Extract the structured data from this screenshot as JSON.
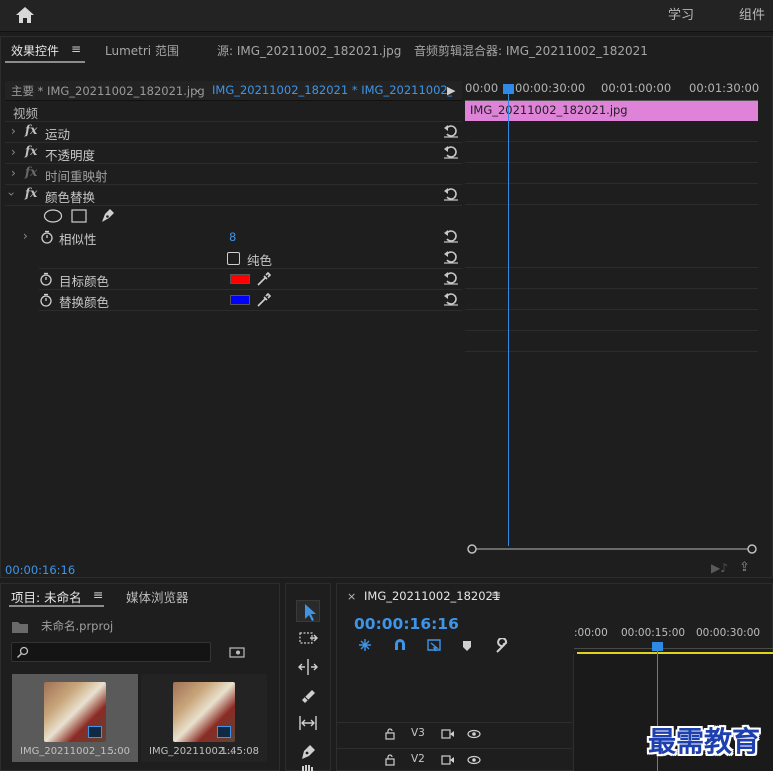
{
  "topbar": {
    "learn": "学习",
    "assembly": "组件"
  },
  "tabs": {
    "effect_controls": "效果控件",
    "lumetri": "Lumetri 范围",
    "source": "源: IMG_20211002_182021.jpg",
    "audio_mixer": "音频剪辑混合器: IMG_20211002_182021"
  },
  "clip_header": {
    "master": "主要 * IMG_20211002_182021.jpg",
    "sequence": "IMG_20211002_182021 * IMG_20211002_..."
  },
  "effects": {
    "video_heading": "视频",
    "motion": "运动",
    "opacity": "不透明度",
    "time_remap": "时间重映射",
    "color_replace": "颜色替换",
    "similarity": "相似性",
    "similarity_value": "8",
    "solid_color": "纯色",
    "target_color": "目标颜色",
    "target_color_hex": "#ff0000",
    "replace_color": "替换颜色",
    "replace_color_hex": "#0000ff"
  },
  "fx_timeline": {
    "tc0": "00:00",
    "tc1": "00:00:30:00",
    "tc2": "00:01:00:00",
    "tc3": "00:01:30:00",
    "clip_label": "IMG_20211002_182021.jpg",
    "current_time": "00:00:16:16"
  },
  "project": {
    "tab": "项目: 未命名",
    "media_browser": "媒体浏览器",
    "file": "未命名.prproj",
    "item1_name": "IMG_20211002_1...",
    "item1_dur": "5:00",
    "item2_name": "IMG_20211002...",
    "item2_dur": "1:45:08"
  },
  "sequence": {
    "tab": "IMG_20211002_182021",
    "timecode": "00:00:16:16",
    "tc0": ":00:00",
    "tc1": "00:00:15:00",
    "tc2": "00:00:30:00",
    "v3": "V3",
    "v2": "V2"
  },
  "watermark": "最需教育"
}
